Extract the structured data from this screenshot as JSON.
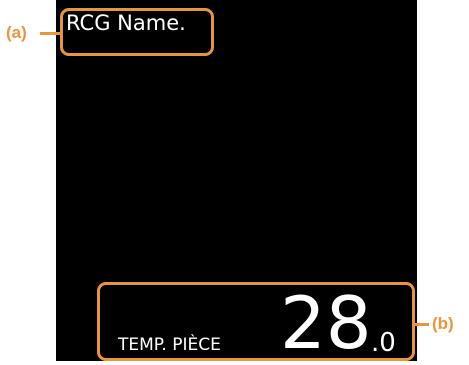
{
  "screen": {
    "rcg_name": "RCG Name.",
    "temperature": {
      "label": "TEMP. PIÈCE",
      "integer": "28",
      "decimal": ".0"
    }
  },
  "callouts": {
    "a": "(a)",
    "b": "(b)"
  },
  "colors": {
    "screen_background": "#000000",
    "screen_text": "#ffffff",
    "callout": "#e8963e"
  }
}
